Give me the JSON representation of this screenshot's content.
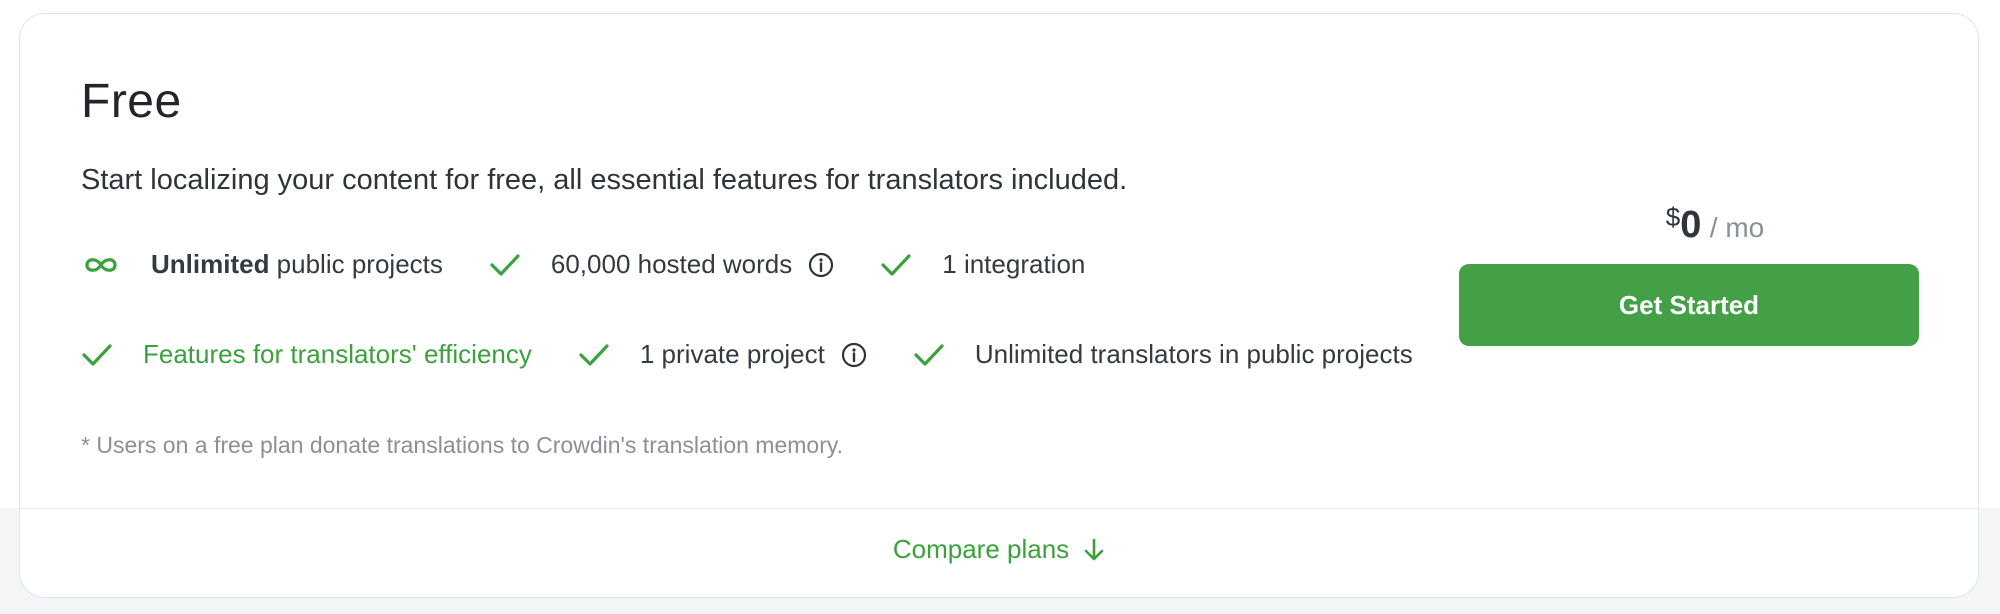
{
  "plan": {
    "title": "Free",
    "description": "Start localizing your content for free, all essential features for translators included."
  },
  "features": {
    "row1": [
      {
        "icon": "infinity-icon",
        "bold": "Unlimited",
        "text": " public projects"
      },
      {
        "icon": "check-icon",
        "text": "60,000 hosted words",
        "info": true
      },
      {
        "icon": "check-icon",
        "text": "1 integration"
      }
    ],
    "row2": [
      {
        "icon": "check-icon",
        "text": "Features for translators' efficiency",
        "link": true
      },
      {
        "icon": "check-icon",
        "text": "1 private project",
        "info": true
      },
      {
        "icon": "check-icon",
        "text": "Unlimited translators in public projects"
      }
    ]
  },
  "note": "* Users on a free plan donate translations to Crowdin's translation memory.",
  "pricing": {
    "currency": "$",
    "amount": "0",
    "period": "/ mo"
  },
  "cta": {
    "label": "Get Started"
  },
  "footer": {
    "compare_label": "Compare plans"
  },
  "colors": {
    "accent_green": "#43a047",
    "link_green": "#3aa23c",
    "text_dark": "#2f343a",
    "text_muted": "#8a9097"
  }
}
